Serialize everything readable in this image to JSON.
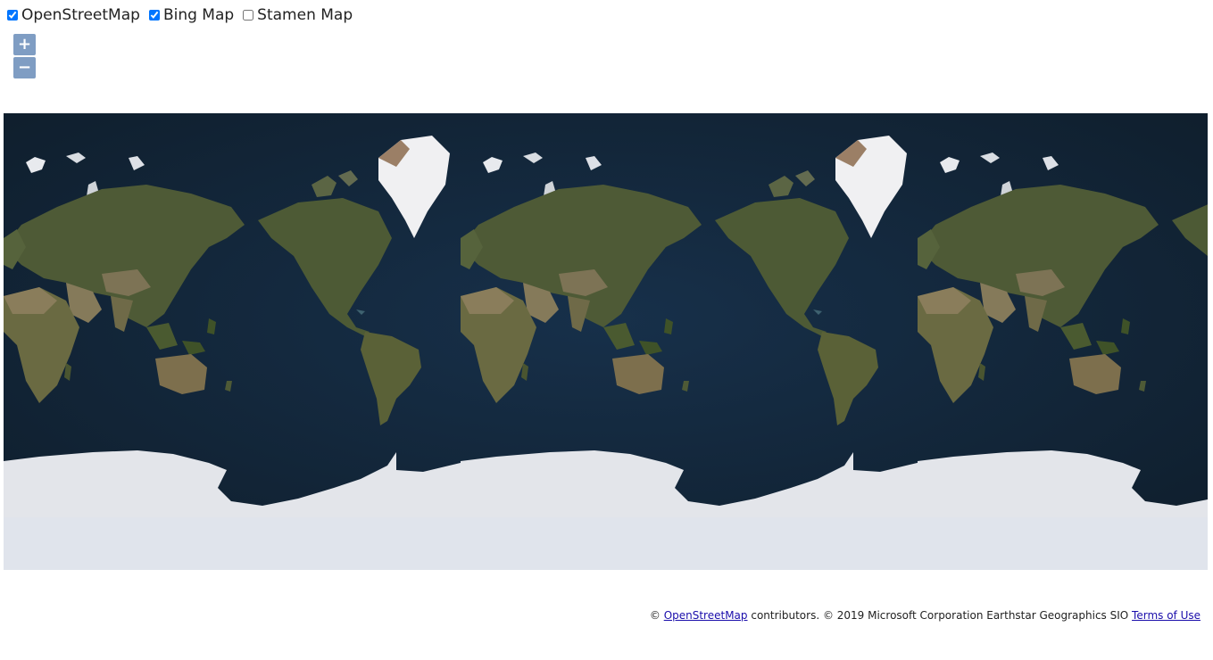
{
  "layers": [
    {
      "label": "OpenStreetMap",
      "checked": true
    },
    {
      "label": "Bing Map",
      "checked": true
    },
    {
      "label": "Stamen Map",
      "checked": false
    }
  ],
  "zoom": {
    "in_label": "+",
    "out_label": "−"
  },
  "attribution": {
    "prefix": "© ",
    "osm_link": "OpenStreetMap",
    "middle": " contributors. © 2019 Microsoft Corporation Earthstar Geographics SIO ",
    "terms_link": "Terms of Use"
  },
  "colors": {
    "ocean": "#14283a",
    "land": "#4e5a36",
    "desert": "#857a5a",
    "ice": "#e6e8ee",
    "greenland": "#f0f0f2",
    "zoom_bg": "#7f9dc4"
  }
}
